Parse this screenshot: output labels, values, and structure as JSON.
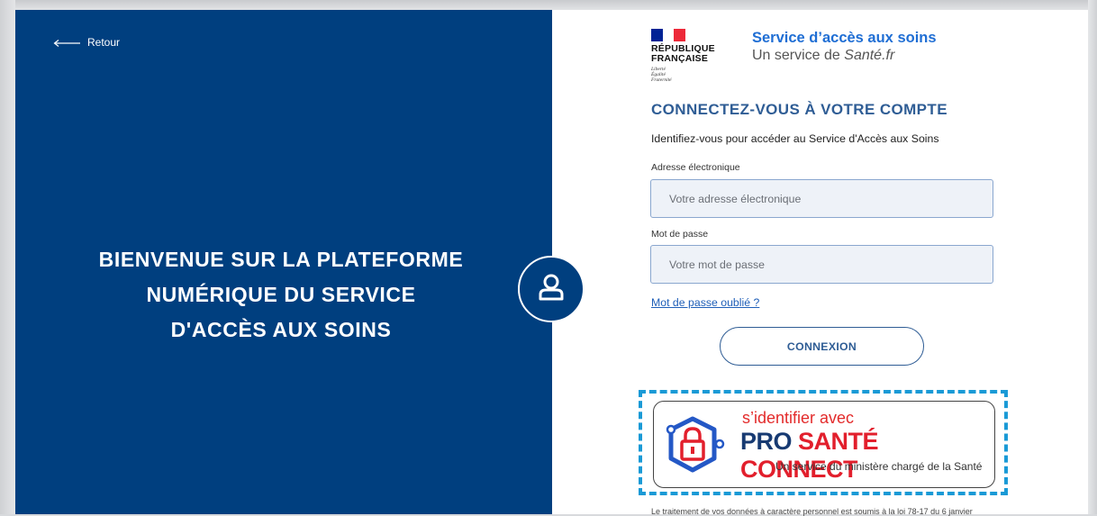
{
  "left": {
    "back_label": "Retour",
    "welcome_lines": [
      "BIENVENUE SUR LA PLATEFORME",
      "NUMÉRIQUE DU SERVICE",
      "D'ACCÈS AUX SOINS"
    ]
  },
  "logo": {
    "name_line1": "RÉPUBLIQUE",
    "name_line2": "FRANÇAISE",
    "motto1": "Liberté",
    "motto2": "Égalité",
    "motto3": "Fraternité"
  },
  "service": {
    "title": "Service d’accès aux soins",
    "subtitle_prefix": "Un service de ",
    "subtitle_brand": "Santé.fr"
  },
  "form": {
    "heading": "CONNECTEZ-VOUS À VOTRE COMPTE",
    "intro": "Identifiez-vous pour accéder au Service d'Accès aux Soins",
    "email_label": "Adresse électronique",
    "email_placeholder": "Votre adresse électronique",
    "email_value": "",
    "password_label": "Mot de passe",
    "password_placeholder": "Votre mot de passe",
    "password_value": "",
    "forgot_label": "Mot de passe oublié ?",
    "submit_label": "CONNEXION"
  },
  "psc": {
    "line1": "s’identifier avec",
    "line2_pro": "PRO ",
    "line2_rest": "SANTÉ CONNECT",
    "line3": "Un service du ministère chargé de la Santé"
  },
  "legal_text": "Le traitement de vos données à caractère personnel est soumis à la loi 78-17 du 6 janvier",
  "colors": {
    "panel_blue": "#003f7f",
    "accent_blue": "#1f6ed4",
    "heading_blue": "#2f5d95",
    "focus_cyan": "#1a9ad6",
    "psc_red": "#e21f2c",
    "psc_navy": "#173a72"
  },
  "icons": {
    "back": "arrow-left-icon",
    "user": "user-icon",
    "psc": "padlock-hexagon-icon"
  }
}
